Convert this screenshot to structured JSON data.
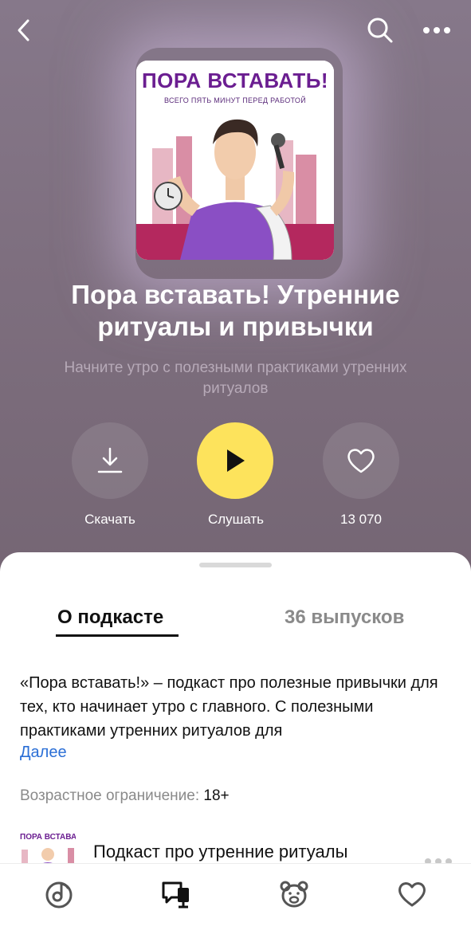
{
  "header": {
    "back_icon": "chevron-left-icon",
    "search_icon": "search-icon",
    "more_icon": "more-horizontal-icon"
  },
  "cover": {
    "title": "ПОРА ВСТАВАТЬ!",
    "subtitle": "ВСЕГО ПЯТЬ МИНУТ ПЕРЕД РАБОТОЙ"
  },
  "podcast": {
    "title": "Пора вставать! Утренние ритуалы и привычки",
    "subtitle": "Начните утро с полезными практиками утренних ритуалов"
  },
  "actions": {
    "download_label": "Скачать",
    "listen_label": "Слушать",
    "likes_count": "13 070"
  },
  "tabs": {
    "about": "О подкасте",
    "episodes": "36 выпусков"
  },
  "about": {
    "description": "«Пора вставать!» – подкаст про полезные привычки для тех, кто начинает утро с главного. С полезными практиками утренних ритуалов для",
    "more_link": "Далее",
    "age_label": "Возрастное ограничение:",
    "age_value": "18+"
  },
  "episode": {
    "thumb_title": "ПОРА ВСТАВАТЬ!",
    "title": "Подкаст про утренние ритуалы"
  },
  "tabbar": {
    "items": [
      "music-icon",
      "podcasts-icon",
      "kids-bear-icon",
      "favorites-heart-icon"
    ]
  },
  "colors": {
    "hero_bg": "#7a6b79",
    "play_accent": "#fde35c",
    "link": "#2b6fd6",
    "cover_title": "#6b1e91"
  }
}
